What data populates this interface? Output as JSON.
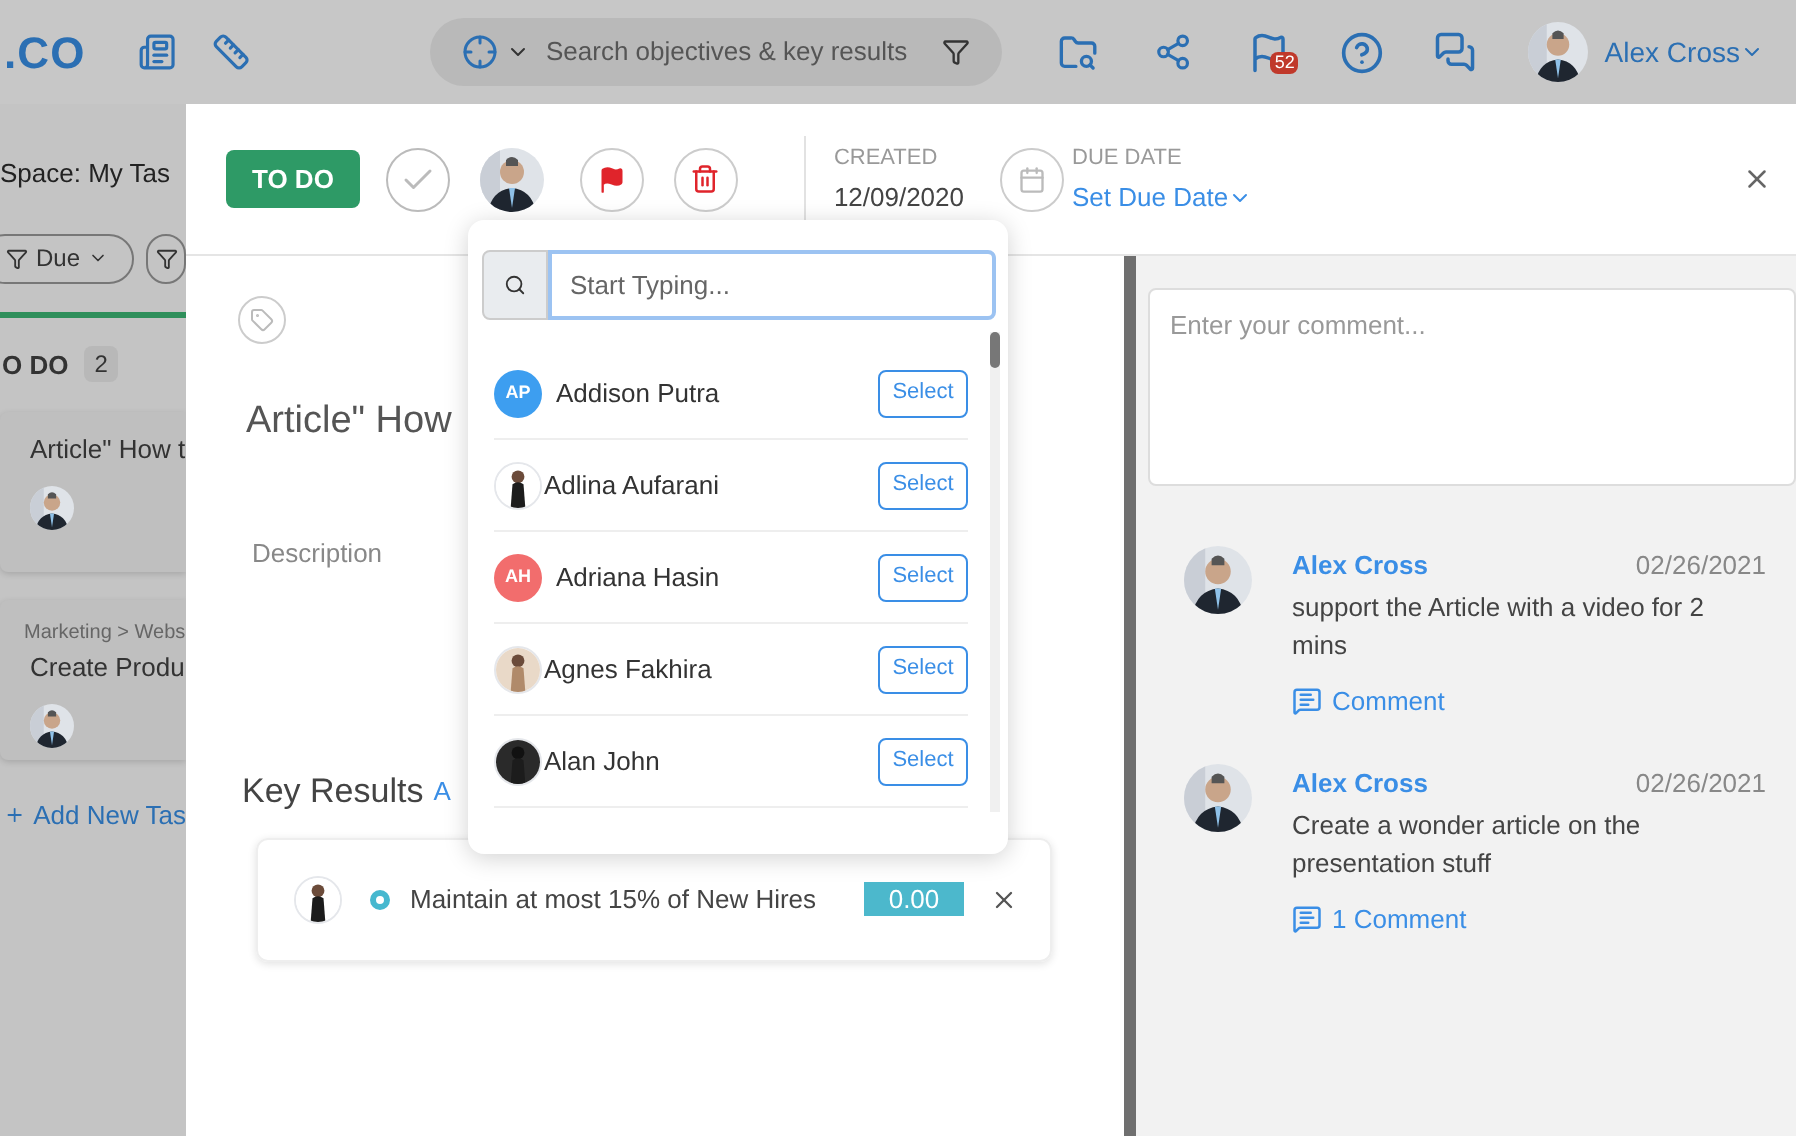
{
  "topbar": {
    "logo": ".CO",
    "search_placeholder": "Search objectives & key results",
    "notification_count": "52",
    "user_name": "Alex Cross"
  },
  "board": {
    "space_title": "Space: My Tas",
    "filters": [
      "Due"
    ],
    "column_title": "O DO",
    "column_count": "2",
    "cards": [
      {
        "title": "Article\" How t"
      },
      {
        "breadcrumb": "Marketing > Webs",
        "title": "Create Produ"
      }
    ],
    "add_task": "Add New Tas"
  },
  "task": {
    "status": "TO DO",
    "created_label": "CREATED",
    "created": "12/09/2020",
    "due_label": "DUE DATE",
    "due_value": "Set Due Date",
    "title": "Article\" How",
    "description_label": "Description",
    "key_results_title": "Key Results",
    "key_results_link": "A",
    "key_results": [
      {
        "text": "Maintain at most 15% of New Hires",
        "value": "0.00"
      }
    ]
  },
  "assignee_picker": {
    "placeholder": "Start Typing...",
    "people": [
      {
        "name": "Addison Putra",
        "kind": "initials",
        "initials": "AP",
        "color": "#3d9ef0",
        "action": "Select"
      },
      {
        "name": "Adlina Aufarani",
        "action": "Select"
      },
      {
        "name": "Adriana Hasin",
        "kind": "initials",
        "initials": "AH",
        "color": "#f26d6d",
        "action": "Select"
      },
      {
        "name": "Agnes Fakhira",
        "action": "Select"
      },
      {
        "name": "Alan John",
        "action": "Select"
      }
    ]
  },
  "comments": {
    "placeholder": "Enter your comment...",
    "items": [
      {
        "author": "Alex Cross",
        "date": "02/26/2021",
        "text": "support the Article with a video for 2 mins",
        "reply": "Comment"
      },
      {
        "author": "Alex Cross",
        "date": "02/26/2021",
        "text": "Create a wonder article on the presentation stuff",
        "reply": "1 Comment"
      }
    ]
  }
}
